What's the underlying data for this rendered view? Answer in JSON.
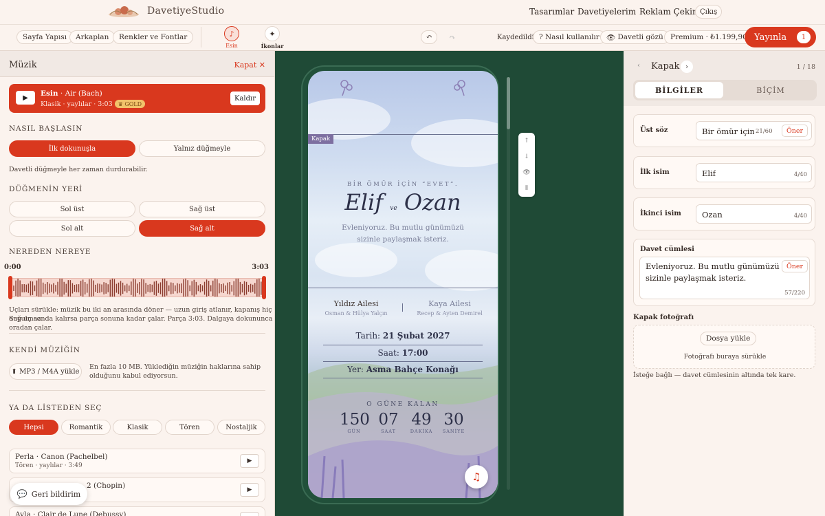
{
  "brand": {
    "name": "DavetiyeStudio"
  },
  "topnav": {
    "designs": "Tasarımlar",
    "invites": "Davetiyelerim",
    "ads": "Reklam Çekimi",
    "logout": "Çıkış"
  },
  "toolbar": {
    "page_layout": "Sayfa Yapısı",
    "background": "Arkaplan",
    "colors_fonts": "Renkler ve Fontlar",
    "esin": "Esin",
    "icons": "İkonlar",
    "saved": "Kaydedildi",
    "how_to": "? Nasıl kullanılır",
    "guest_view": "Davetli gözü",
    "premium": "Premium · ₺1.199,90",
    "publish": "Yayınla",
    "publish_count": "1"
  },
  "left": {
    "title": "Müzik",
    "close": "Kapat ✕",
    "now": {
      "name": "Esin",
      "piece": "· Air (Bach)",
      "meta": "Klasik · yaylılar · 3:03",
      "badge": "GOLD",
      "remove": "Kaldır"
    },
    "start_title": "NASIL BAŞLASIN",
    "start_opt1": "İlk dokunuşla",
    "start_opt2": "Yalnız düğmeyle",
    "start_note": "Davetli düğmeyle her zaman durdurabilir.",
    "pos_title": "DÜĞMENİN YERİ",
    "pos": [
      "Sol üst",
      "Sağ üst",
      "Sol alt",
      "Sağ alt"
    ],
    "range_title": "NEREDEN NEREYE",
    "t_start": "0:00",
    "t_end": "3:03",
    "range_note1": "Uçları sürükle: müzik bu iki an arasında döner — uzun giriş atlanır, kapanış hiç duyulmaz.",
    "range_note2": "Sağ uç sonda kalırsa parça sonuna kadar çalar. Parça 3:03. Dalgaya dokununca oradan çalar.",
    "own_title": "KENDİ MÜZİĞİN",
    "upload": "⬆ MP3 / M4A yükle",
    "own_note": "En fazla 10 MB. Yüklediğin müziğin haklarına sahip olduğunu kabul ediyorsun.",
    "list_title": "YA DA LİSTEDEN SEÇ",
    "chips": [
      "Hepsi",
      "Romantik",
      "Klasik",
      "Tören",
      "Nostaljik"
    ],
    "songs": [
      {
        "a": "Perla · Canon (Pachelbel)",
        "b": "Tören · yaylılar · 3:49"
      },
      {
        "a": "2 (Chopin)",
        "b": ""
      },
      {
        "a": "Ayla · Clair de Lune (Debussy)",
        "b": ""
      }
    ],
    "feedback": "Geri bildirim"
  },
  "invite": {
    "tag": "Kapak",
    "pre": "BİR ÖMÜR İÇİN “EVET”.",
    "name1": "Elif",
    "and": "ve",
    "name2": "Ozan",
    "message": "Evleniyoruz. Bu mutlu günümüzü sizinle paylaşmak isteriz.",
    "fam1": "Yıldız Ailesi",
    "fam1_sub": "Osman & Hülya Yalçın",
    "fam2": "Kaya Ailesi",
    "fam2_sub": "Recep & Ayten Demirel",
    "date_l": "Tarih:",
    "date_v": "21 Şubat 2027",
    "time_l": "Saat:",
    "time_v": "17:00",
    "place_l": "Yer:",
    "place_v": "Asma Bahçe Konağı",
    "countdown_title": "O GÜNE KALAN",
    "cd": [
      {
        "v": "150",
        "l": "GÜN"
      },
      {
        "v": "07",
        "l": "SAAT"
      },
      {
        "v": "49",
        "l": "DAKİKA"
      },
      {
        "v": "30",
        "l": "SANİYE"
      }
    ]
  },
  "right": {
    "title": "Kapak",
    "page": "1 / 18",
    "tab1": "BİLGİLER",
    "tab2": "BİÇİM",
    "f1_label": "Üst söz",
    "f1_value": "Bir ömür için “",
    "f1_count": "21/60",
    "suggest": "Öner",
    "f2_label": "İlk isim",
    "f2_value": "Elif",
    "f2_count": "4/40",
    "f3_label": "İkinci isim",
    "f3_value": "Ozan",
    "f3_count": "4/40",
    "f4_label": "Davet cümlesi",
    "f4_value": "Evleniyoruz. Bu mutlu günümüzü sizinle paylaşmak isteriz.",
    "f4_count": "57/220",
    "photo_title": "Kapak fotoğrafı",
    "photo_upload": "Dosya yükle",
    "photo_hint": "Fotoğrafı buraya sürükle",
    "photo_note": "İsteğe bağlı — davet cümlesinin altında tek kare."
  },
  "colors": {
    "accent": "#d9381e",
    "canvas": "#1f4a36",
    "panel": "#fbf3ee"
  }
}
